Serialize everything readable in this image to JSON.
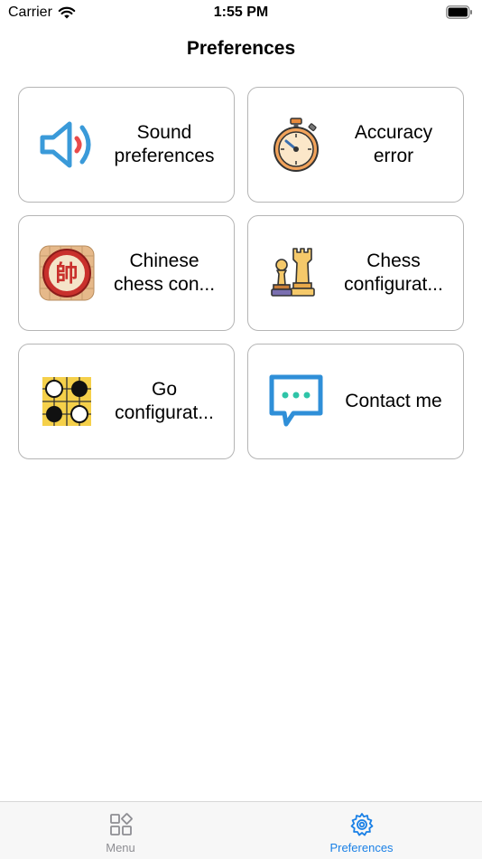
{
  "status_bar": {
    "carrier": "Carrier",
    "time": "1:55 PM"
  },
  "nav": {
    "title": "Preferences"
  },
  "cards": [
    {
      "label": "Sound\npreferences",
      "icon": "speaker-icon"
    },
    {
      "label": "Accuracy\nerror",
      "icon": "stopwatch-icon"
    },
    {
      "label": "Chinese\nchess con...",
      "icon": "xiangqi-piece-icon"
    },
    {
      "label": "Chess\nconfigurat...",
      "icon": "chess-pieces-icon"
    },
    {
      "label": "Go\nconfigurat...",
      "icon": "go-board-icon"
    },
    {
      "label": "Contact me",
      "icon": "chat-bubble-icon"
    }
  ],
  "xiangqi_glyph": "帥",
  "tabs": [
    {
      "label": "Menu",
      "icon": "grid-icon",
      "selected": false
    },
    {
      "label": "Preferences",
      "icon": "gear-icon",
      "selected": true
    }
  ],
  "colors": {
    "accent": "#1a80e6",
    "card_border": "#b5b5b5",
    "inactive_tab": "#8e8e93"
  }
}
